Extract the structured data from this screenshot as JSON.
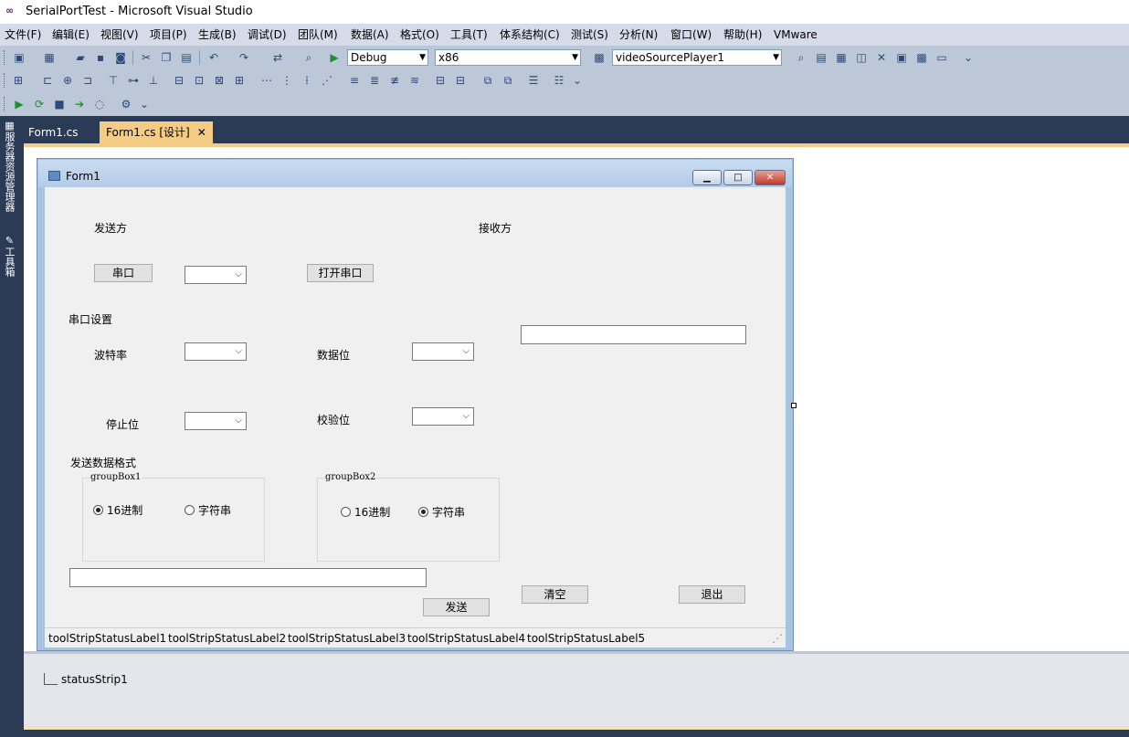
{
  "window": {
    "title": "SerialPortTest - Microsoft Visual Studio",
    "logo_icon": "vs-infinity-icon"
  },
  "menu": [
    "文件(F)",
    "编辑(E)",
    "视图(V)",
    "项目(P)",
    "生成(B)",
    "调试(D)",
    "团队(M)",
    "数据(A)",
    "格式(O)",
    "工具(T)",
    "体系结构(C)",
    "测试(S)",
    "分析(N)",
    "窗口(W)",
    "帮助(H)",
    "VMware"
  ],
  "toolbar": {
    "config": "Debug",
    "platform": "x86",
    "object": "videoSourcePlayer1",
    "run_icon": "start-debug-icon"
  },
  "side_panels": {
    "server_explorer": "服务器资源管理器",
    "toolbox": "工具箱"
  },
  "tabs": [
    {
      "label": "Form1.cs"
    },
    {
      "label": "Form1.cs [设计]",
      "close": "✕"
    }
  ],
  "form": {
    "title": "Form1",
    "labels": {
      "sender": "发送方",
      "receiver": "接收方",
      "serial_settings": "串口设置",
      "baud_rate": "波特率",
      "data_bits": "数据位",
      "stop_bits": "停止位",
      "parity": "校验位",
      "send_format": "发送数据格式"
    },
    "buttons": {
      "port": "串口",
      "open_port": "打开串口",
      "send": "发送",
      "clear": "清空",
      "exit": "退出"
    },
    "groupbox1": {
      "title": "groupBox1",
      "radio_hex": "16进制",
      "radio_str": "字符串",
      "selected": "hex"
    },
    "groupbox2": {
      "title": "groupBox2",
      "radio_hex": "16进制",
      "radio_str": "字符串",
      "selected": "str"
    },
    "status_labels": [
      "toolStripStatusLabel1",
      "toolStripStatusLabel2",
      "toolStripStatusLabel3",
      "toolStripStatusLabel4",
      "toolStripStatusLabel5"
    ]
  },
  "component_tray": {
    "item": "statusStrip1"
  }
}
